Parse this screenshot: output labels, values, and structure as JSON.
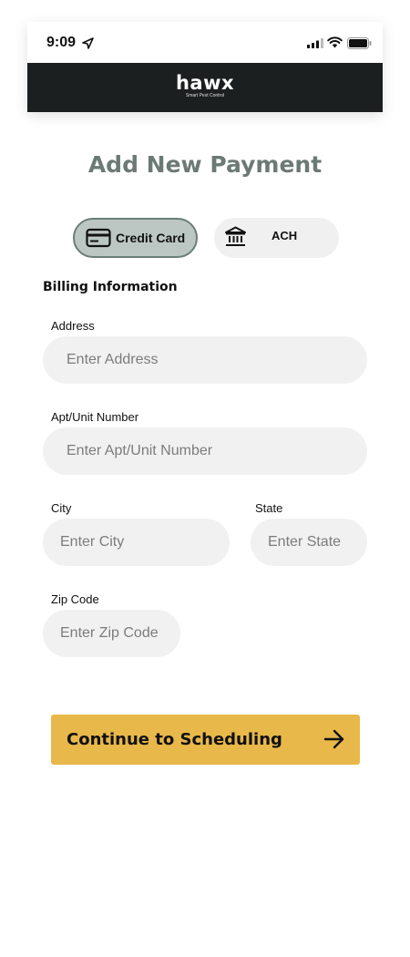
{
  "status_bar": {
    "time": "9:09",
    "icons": [
      "location-arrow-icon",
      "cellular-signal-icon",
      "wifi-icon",
      "battery-icon"
    ]
  },
  "header": {
    "logo_text": "hawx",
    "logo_tagline": "Smart Pest Control"
  },
  "page": {
    "title": "Add New Payment"
  },
  "payment_tabs": [
    {
      "label": "Credit Card",
      "icon": "credit-card-icon",
      "selected": true
    },
    {
      "label": "ACH",
      "icon": "bank-icon",
      "selected": false
    }
  ],
  "billing": {
    "section_title": "Billing Information",
    "fields": {
      "address": {
        "label": "Address",
        "placeholder": "Enter Address",
        "value": ""
      },
      "apt": {
        "label": "Apt/Unit Number",
        "placeholder": "Enter Apt/Unit Number",
        "value": ""
      },
      "city": {
        "label": "City",
        "placeholder": "Enter City",
        "value": ""
      },
      "state": {
        "label": "State",
        "placeholder": "Enter State",
        "value": ""
      },
      "zip": {
        "label": "Zip Code",
        "placeholder": "Enter Zip Code",
        "value": ""
      }
    }
  },
  "actions": {
    "continue_label": "Continue to Scheduling",
    "continue_icon": "arrow-right-icon"
  },
  "colors": {
    "header_bg": "#1b1f1f",
    "title": "#6c7a76",
    "tab_selected_bg": "#bcc7c4",
    "tab_selected_border": "#6b7e79",
    "input_bg": "#f1f1f1",
    "button_bg": "#e9b84a"
  }
}
